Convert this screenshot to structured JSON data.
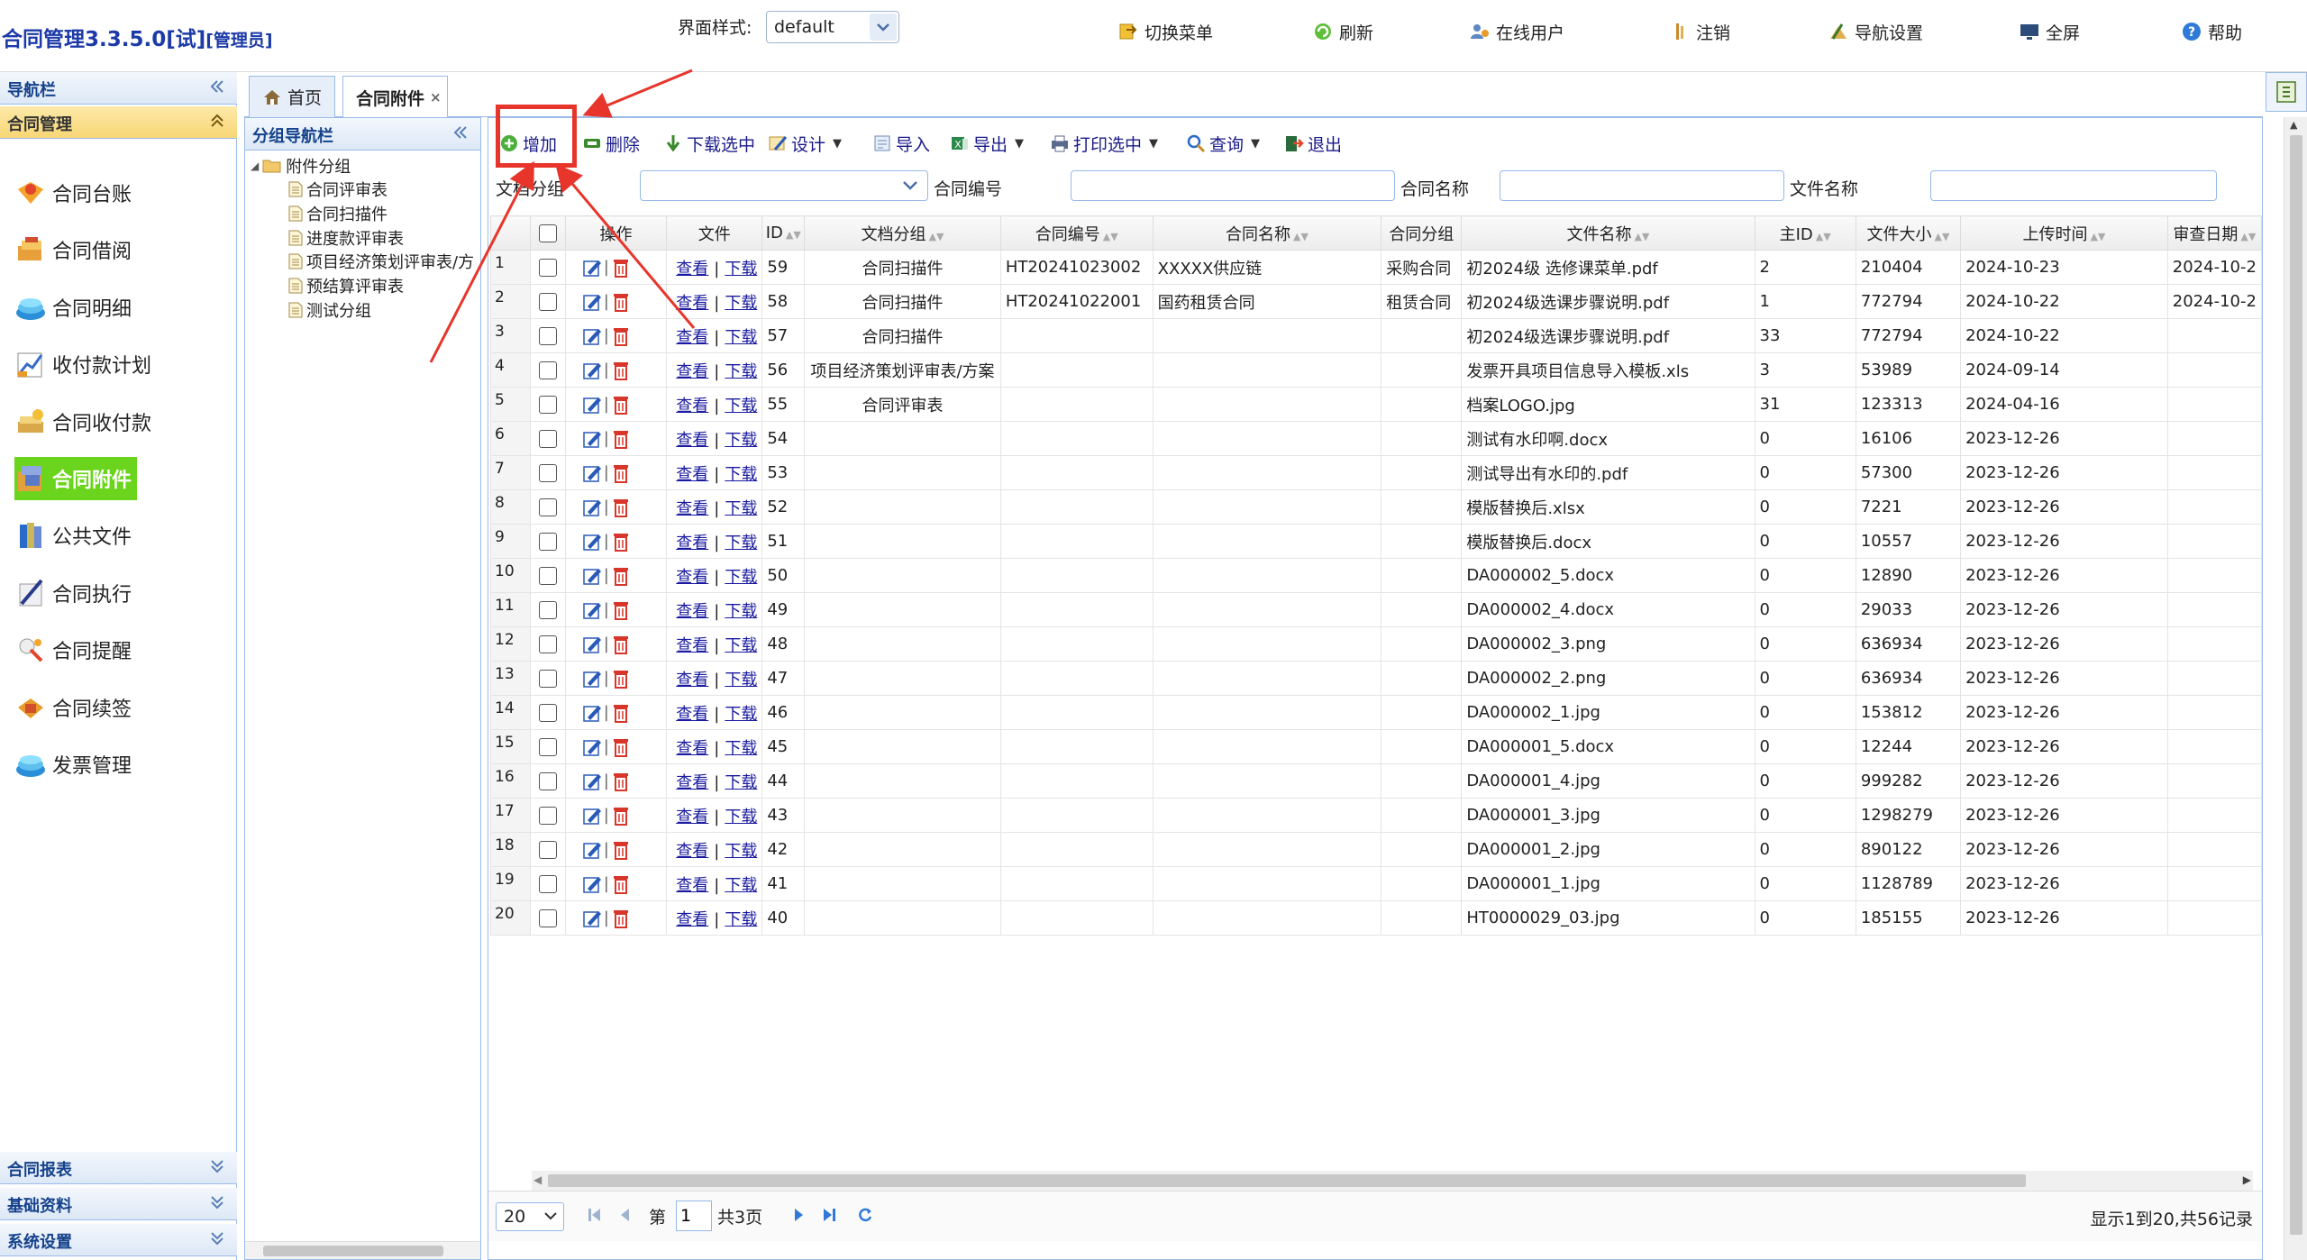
{
  "header": {
    "app_title": "合同管理3.3.5.0[试]",
    "user_role": "[管理员]",
    "style_label": "界面样式:",
    "style_value": "default",
    "buttons": [
      {
        "label": "切换菜单",
        "icon": "switch-menu-icon"
      },
      {
        "label": "刷新",
        "icon": "refresh-icon"
      },
      {
        "label": "在线用户",
        "icon": "online-users-icon"
      },
      {
        "label": "注销",
        "icon": "logout-icon"
      },
      {
        "label": "导航设置",
        "icon": "nav-settings-icon"
      },
      {
        "label": "全屏",
        "icon": "fullscreen-icon"
      },
      {
        "label": "帮助",
        "icon": "help-icon"
      }
    ]
  },
  "left_nav": {
    "title": "导航栏",
    "section_title": "合同管理",
    "items": [
      {
        "label": "合同台账",
        "icon": "contract-ledger-icon"
      },
      {
        "label": "合同借阅",
        "icon": "contract-borrow-icon"
      },
      {
        "label": "合同明细",
        "icon": "contract-detail-icon"
      },
      {
        "label": "收付款计划",
        "icon": "payment-plan-icon"
      },
      {
        "label": "合同收付款",
        "icon": "contract-payment-icon"
      },
      {
        "label": "合同附件",
        "icon": "contract-attachment-icon",
        "active": true
      },
      {
        "label": "公共文件",
        "icon": "public-files-icon"
      },
      {
        "label": "合同执行",
        "icon": "contract-execution-icon"
      },
      {
        "label": "合同提醒",
        "icon": "contract-reminder-icon"
      },
      {
        "label": "合同续签",
        "icon": "contract-renewal-icon"
      },
      {
        "label": "发票管理",
        "icon": "invoice-icon"
      }
    ],
    "bottom_sections": [
      "合同报表",
      "基础资料",
      "系统设置"
    ]
  },
  "tabs": [
    {
      "label": "首页",
      "icon": "home-icon"
    },
    {
      "label": "合同附件",
      "active": true
    }
  ],
  "group_nav": {
    "title": "分组导航栏",
    "root": "附件分组",
    "children": [
      "合同评审表",
      "合同扫描件",
      "进度款评审表",
      "项目经济策划评审表/方",
      "预结算评审表",
      "测试分组"
    ]
  },
  "toolbar": {
    "buttons": [
      {
        "label": "增加",
        "icon": "add-icon"
      },
      {
        "label": "删除",
        "icon": "delete-icon"
      },
      {
        "label": "下载选中",
        "icon": "download-icon"
      },
      {
        "label": "设计",
        "icon": "design-icon",
        "dropdown": true
      },
      {
        "label": "导入",
        "icon": "import-icon"
      },
      {
        "label": "导出",
        "icon": "export-icon",
        "dropdown": true
      },
      {
        "label": "打印选中",
        "icon": "print-icon",
        "dropdown": true
      },
      {
        "label": "查询",
        "icon": "search-icon",
        "dropdown": true
      },
      {
        "label": "退出",
        "icon": "exit-icon"
      }
    ]
  },
  "filters": {
    "doc_group": "文档分组",
    "contract_no": "合同编号",
    "contract_name": "合同名称",
    "file_name": "文件名称"
  },
  "table": {
    "columns": [
      "操作",
      "文件",
      "ID",
      "文档分组",
      "合同编号",
      "合同名称",
      "合同分组",
      "文件名称",
      "主ID",
      "文件大小",
      "上传时间",
      "审查日期"
    ],
    "view_label": "查看",
    "download_label": "下载",
    "rows": [
      {
        "n": "1",
        "id": "59",
        "group": "合同扫描件",
        "cno": "HT20241023002",
        "cname": "XXXXX供应链",
        "cgroup": "采购合同",
        "fname": "初2024级 选修课菜单.pdf",
        "mid": "2",
        "size": "210404",
        "time": "2024-10-23",
        "review": "2024-10-2"
      },
      {
        "n": "2",
        "id": "58",
        "group": "合同扫描件",
        "cno": "HT20241022001",
        "cname": "国药租赁合同",
        "cgroup": "租赁合同",
        "fname": "初2024级选课步骤说明.pdf",
        "mid": "1",
        "size": "772794",
        "time": "2024-10-22",
        "review": "2024-10-2"
      },
      {
        "n": "3",
        "id": "57",
        "group": "合同扫描件",
        "cno": "",
        "cname": "",
        "cgroup": "",
        "fname": "初2024级选课步骤说明.pdf",
        "mid": "33",
        "size": "772794",
        "time": "2024-10-22",
        "review": ""
      },
      {
        "n": "4",
        "id": "56",
        "group": "项目经济策划评审表/方案",
        "cno": "",
        "cname": "",
        "cgroup": "",
        "fname": "发票开具项目信息导入模板.xls",
        "mid": "3",
        "size": "53989",
        "time": "2024-09-14",
        "review": ""
      },
      {
        "n": "5",
        "id": "55",
        "group": "合同评审表",
        "cno": "",
        "cname": "",
        "cgroup": "",
        "fname": "档案LOGO.jpg",
        "mid": "31",
        "size": "123313",
        "time": "2024-04-16",
        "review": ""
      },
      {
        "n": "6",
        "id": "54",
        "group": "",
        "cno": "",
        "cname": "",
        "cgroup": "",
        "fname": "测试有水印啊.docx",
        "mid": "0",
        "size": "16106",
        "time": "2023-12-26",
        "review": ""
      },
      {
        "n": "7",
        "id": "53",
        "group": "",
        "cno": "",
        "cname": "",
        "cgroup": "",
        "fname": "测试导出有水印的.pdf",
        "mid": "0",
        "size": "57300",
        "time": "2023-12-26",
        "review": ""
      },
      {
        "n": "8",
        "id": "52",
        "group": "",
        "cno": "",
        "cname": "",
        "cgroup": "",
        "fname": "模版替换后.xlsx",
        "mid": "0",
        "size": "7221",
        "time": "2023-12-26",
        "review": ""
      },
      {
        "n": "9",
        "id": "51",
        "group": "",
        "cno": "",
        "cname": "",
        "cgroup": "",
        "fname": "模版替换后.docx",
        "mid": "0",
        "size": "10557",
        "time": "2023-12-26",
        "review": ""
      },
      {
        "n": "10",
        "id": "50",
        "group": "",
        "cno": "",
        "cname": "",
        "cgroup": "",
        "fname": "DA000002_5.docx",
        "mid": "0",
        "size": "12890",
        "time": "2023-12-26",
        "review": ""
      },
      {
        "n": "11",
        "id": "49",
        "group": "",
        "cno": "",
        "cname": "",
        "cgroup": "",
        "fname": "DA000002_4.docx",
        "mid": "0",
        "size": "29033",
        "time": "2023-12-26",
        "review": ""
      },
      {
        "n": "12",
        "id": "48",
        "group": "",
        "cno": "",
        "cname": "",
        "cgroup": "",
        "fname": "DA000002_3.png",
        "mid": "0",
        "size": "636934",
        "time": "2023-12-26",
        "review": ""
      },
      {
        "n": "13",
        "id": "47",
        "group": "",
        "cno": "",
        "cname": "",
        "cgroup": "",
        "fname": "DA000002_2.png",
        "mid": "0",
        "size": "636934",
        "time": "2023-12-26",
        "review": ""
      },
      {
        "n": "14",
        "id": "46",
        "group": "",
        "cno": "",
        "cname": "",
        "cgroup": "",
        "fname": "DA000002_1.jpg",
        "mid": "0",
        "size": "153812",
        "time": "2023-12-26",
        "review": ""
      },
      {
        "n": "15",
        "id": "45",
        "group": "",
        "cno": "",
        "cname": "",
        "cgroup": "",
        "fname": "DA000001_5.docx",
        "mid": "0",
        "size": "12244",
        "time": "2023-12-26",
        "review": ""
      },
      {
        "n": "16",
        "id": "44",
        "group": "",
        "cno": "",
        "cname": "",
        "cgroup": "",
        "fname": "DA000001_4.jpg",
        "mid": "0",
        "size": "999282",
        "time": "2023-12-26",
        "review": ""
      },
      {
        "n": "17",
        "id": "43",
        "group": "",
        "cno": "",
        "cname": "",
        "cgroup": "",
        "fname": "DA000001_3.jpg",
        "mid": "0",
        "size": "1298279",
        "time": "2023-12-26",
        "review": ""
      },
      {
        "n": "18",
        "id": "42",
        "group": "",
        "cno": "",
        "cname": "",
        "cgroup": "",
        "fname": "DA000001_2.jpg",
        "mid": "0",
        "size": "890122",
        "time": "2023-12-26",
        "review": ""
      },
      {
        "n": "19",
        "id": "41",
        "group": "",
        "cno": "",
        "cname": "",
        "cgroup": "",
        "fname": "DA000001_1.jpg",
        "mid": "0",
        "size": "1128789",
        "time": "2023-12-26",
        "review": ""
      },
      {
        "n": "20",
        "id": "40",
        "group": "",
        "cno": "",
        "cname": "",
        "cgroup": "",
        "fname": "HT0000029_03.jpg",
        "mid": "0",
        "size": "185155",
        "time": "2023-12-26",
        "review": ""
      }
    ]
  },
  "pager": {
    "page_size": "20",
    "page_prefix": "第",
    "page_value": "1",
    "page_total": "共3页",
    "summary": "显示1到20,共56记录"
  },
  "colors": {
    "accent_red": "#e8352b",
    "active_nav": "#6bd41c",
    "link": "#1a1aa0",
    "title_blue": "#1c3aa8"
  }
}
